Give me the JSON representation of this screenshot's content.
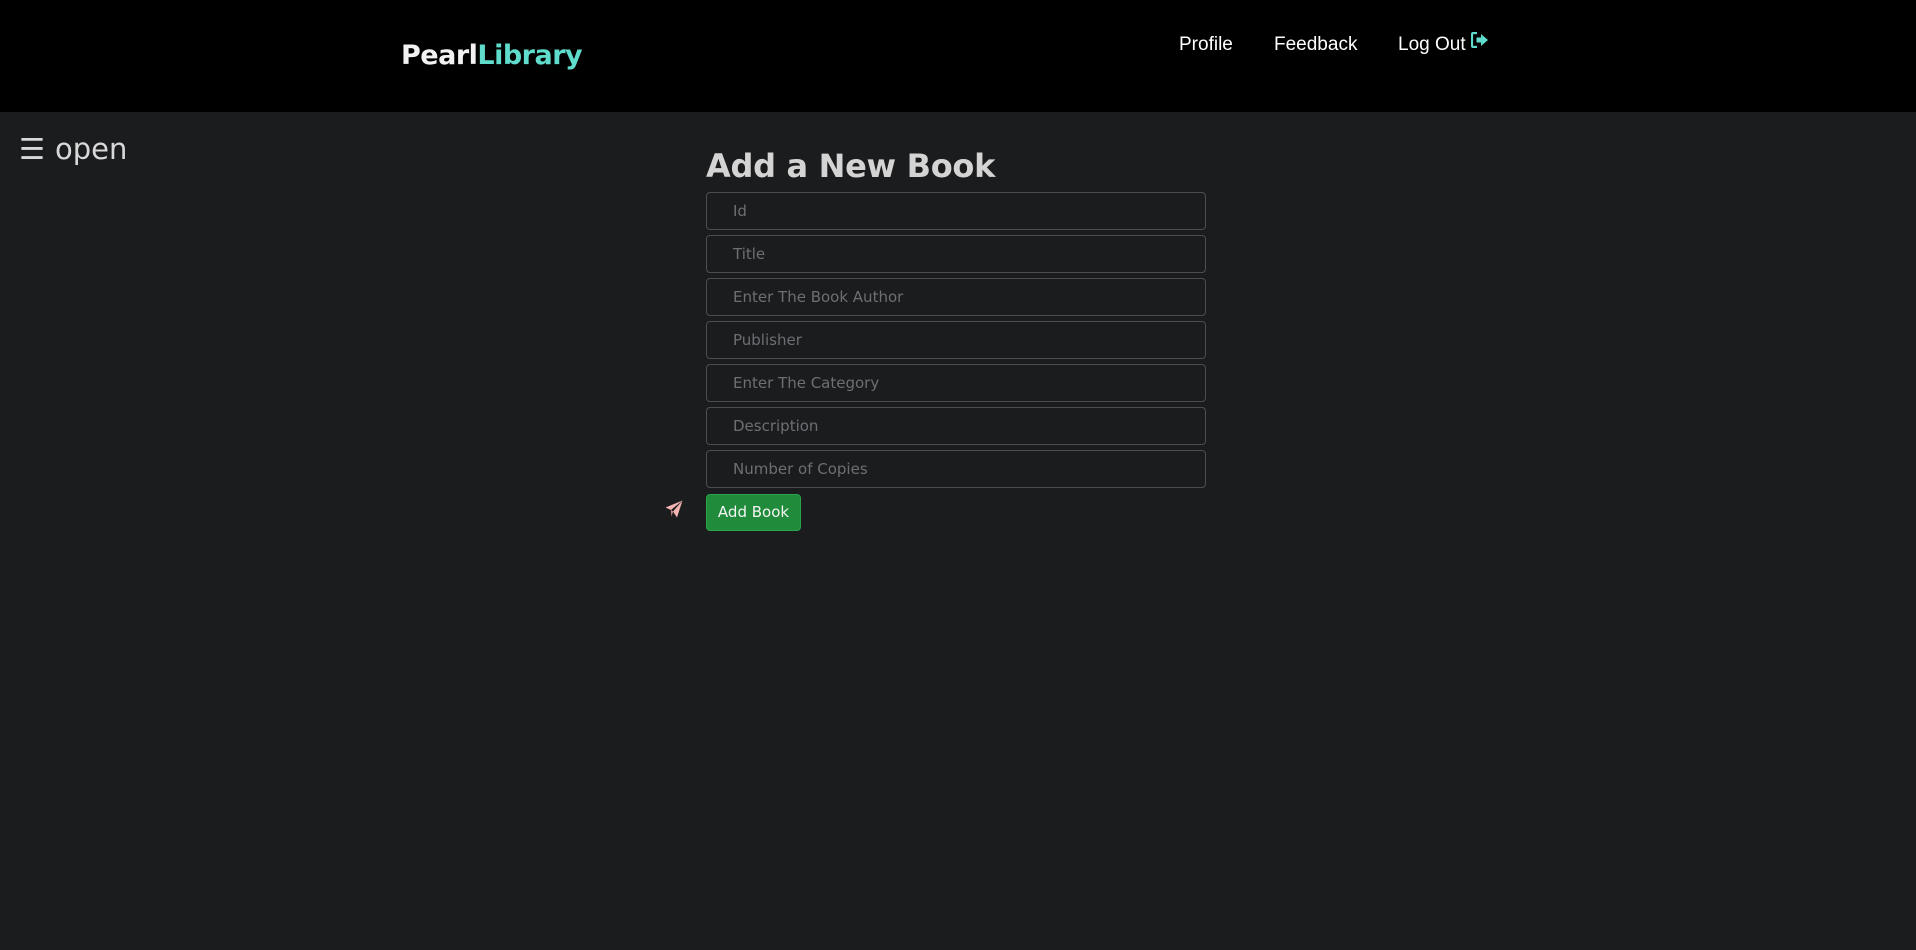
{
  "header": {
    "brand_part1": "Pearl",
    "brand_part2": "Library",
    "brand_color_1": "#f2f2f2",
    "brand_color_2": "#5fdccb",
    "nav": {
      "profile": "Profile",
      "feedback": "Feedback",
      "logout": "Log Out"
    },
    "logout_icon": "sign-out-icon"
  },
  "sidebar": {
    "toggle_icon": "☰",
    "toggle_label": "open"
  },
  "form": {
    "title": "Add a New Book",
    "fields": {
      "id": {
        "placeholder": "Id",
        "value": ""
      },
      "title": {
        "placeholder": "Title",
        "value": ""
      },
      "author": {
        "placeholder": "Enter The Book Author",
        "value": ""
      },
      "publisher": {
        "placeholder": "Publisher",
        "value": ""
      },
      "category": {
        "placeholder": "Enter The Category",
        "value": ""
      },
      "description": {
        "placeholder": "Description",
        "value": ""
      },
      "copies": {
        "placeholder": "Number of Copies",
        "value": ""
      }
    },
    "submit_label": "Add Book",
    "submit_color": "#1f8b3b",
    "send_icon": "paper-plane-icon",
    "send_icon_color": "#f4b4b4"
  },
  "colors": {
    "navbar_bg": "#000000",
    "page_bg": "#1b1c1e",
    "accent": "#5fdccb"
  }
}
